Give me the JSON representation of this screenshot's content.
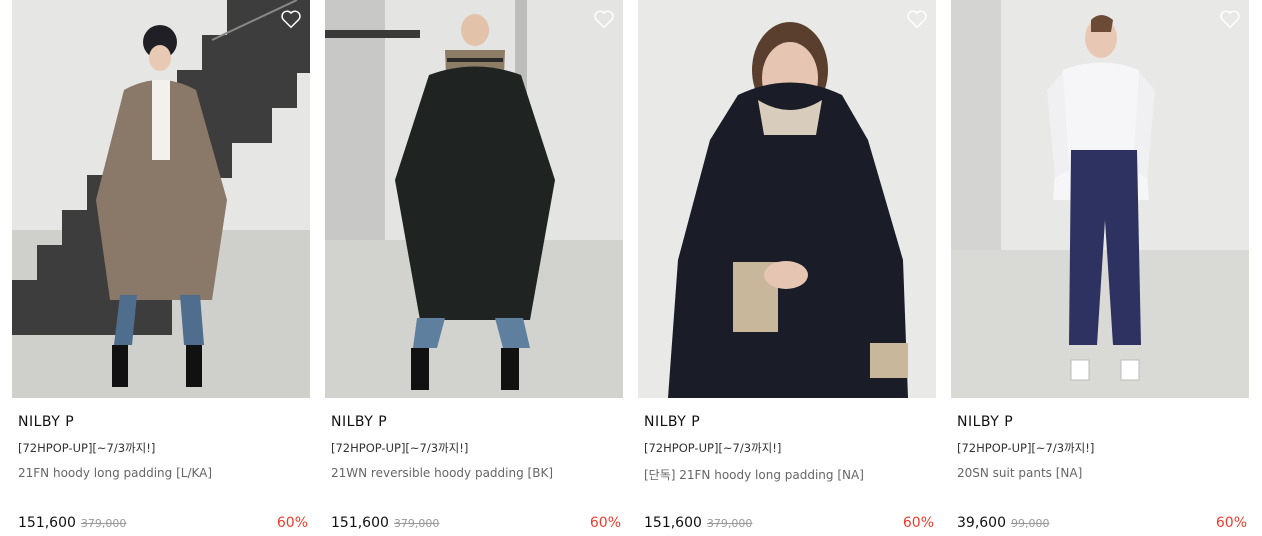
{
  "accent": {
    "discount": "#ee3b2b"
  },
  "products": [
    {
      "brand": "NILBY P",
      "promo": "[72HPOP-UP][~7/3까지!]",
      "name": "21FN hoody long padding [L/KA]",
      "price": "151,600",
      "original_price": "379,000",
      "discount": "60%",
      "wishlist_icon": "heart-outline-icon"
    },
    {
      "brand": "NILBY P",
      "promo": "[72HPOP-UP][~7/3까지!]",
      "name": "21WN reversible hoody padding [BK]",
      "price": "151,600",
      "original_price": "379,000",
      "discount": "60%",
      "wishlist_icon": "heart-outline-icon"
    },
    {
      "brand": "NILBY P",
      "promo": "[72HPOP-UP][~7/3까지!]",
      "name": "[단독] 21FN hoody long padding [NA]",
      "price": "151,600",
      "original_price": "379,000",
      "discount": "60%",
      "wishlist_icon": "heart-outline-icon"
    },
    {
      "brand": "NILBY P",
      "promo": "[72HPOP-UP][~7/3까지!]",
      "name": "20SN suit pants [NA]",
      "price": "39,600",
      "original_price": "99,000",
      "discount": "60%",
      "wishlist_icon": "heart-outline-icon"
    }
  ]
}
